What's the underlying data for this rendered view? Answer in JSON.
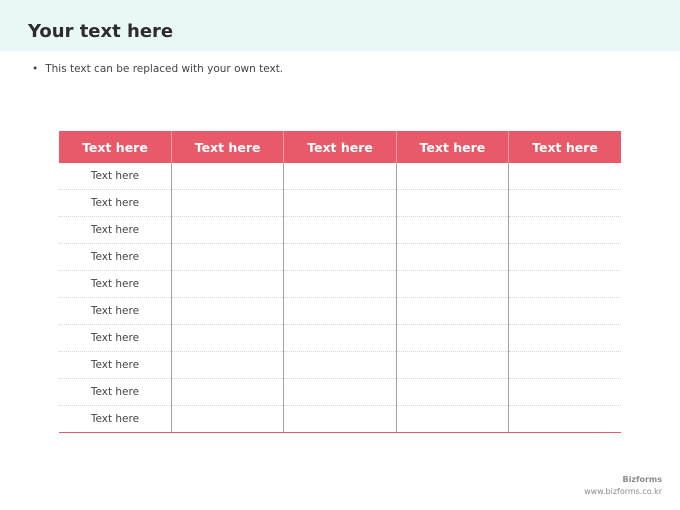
{
  "header": {
    "title": "Your text here"
  },
  "bullet": {
    "marker": "•",
    "text": "This text can be replaced with your own text."
  },
  "table": {
    "headers": [
      "Text here",
      "Text here",
      "Text here",
      "Text here",
      "Text here"
    ],
    "rows": [
      [
        "Text here",
        "",
        "",
        "",
        ""
      ],
      [
        "Text here",
        "",
        "",
        "",
        ""
      ],
      [
        "Text here",
        "",
        "",
        "",
        ""
      ],
      [
        "Text here",
        "",
        "",
        "",
        ""
      ],
      [
        "Text here",
        "",
        "",
        "",
        ""
      ],
      [
        "Text here",
        "",
        "",
        "",
        ""
      ],
      [
        "Text here",
        "",
        "",
        "",
        ""
      ],
      [
        "Text here",
        "",
        "",
        "",
        ""
      ],
      [
        "Text here",
        "",
        "",
        "",
        ""
      ],
      [
        "Text here",
        "",
        "",
        "",
        ""
      ]
    ]
  },
  "footer": {
    "brand": "Bizforms",
    "url": "www.bizforms.co.kr"
  },
  "colors": {
    "header_fill": "#e8596a",
    "title_band": "#e9f7f7"
  }
}
